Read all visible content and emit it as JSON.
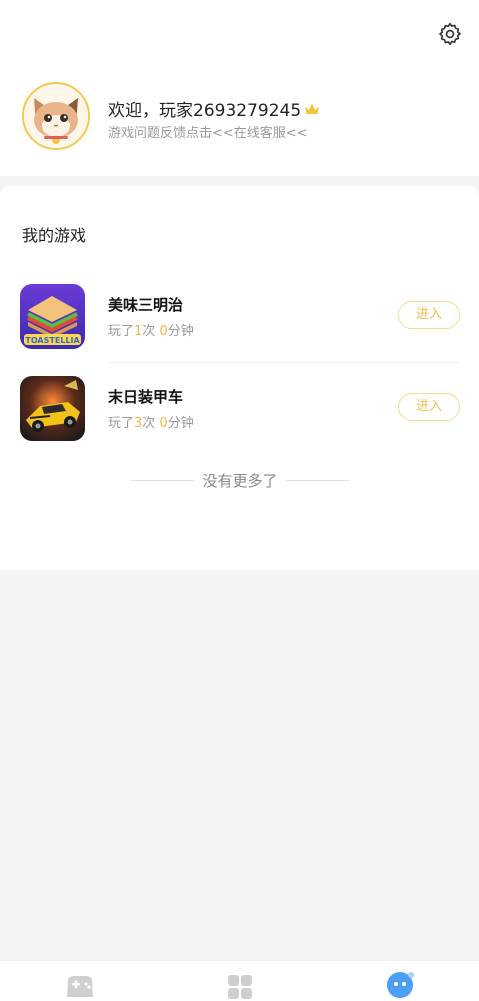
{
  "header": {
    "welcome_text": "欢迎，玩家2693279245",
    "feedback_text": "游戏问题反馈点击<<在线客服<<",
    "icons": {
      "settings": "gear-icon",
      "vip": "crown-icon",
      "avatar": "cat-avatar"
    }
  },
  "my_games": {
    "title": "我的游戏",
    "games": [
      {
        "name": "美味三明治",
        "icon": "sandwich-game-icon",
        "icon_text": "TOASTELLIA",
        "played_prefix": "玩了",
        "play_count": "1",
        "count_unit": "次",
        "minutes": "0",
        "minutes_unit": "分钟",
        "enter_label": "进入"
      },
      {
        "name": "末日装甲车",
        "icon": "armored-car-game-icon",
        "played_prefix": "玩了",
        "play_count": "3",
        "count_unit": "次",
        "minutes": "0",
        "minutes_unit": "分钟",
        "enter_label": "进入"
      }
    ],
    "end_text": "没有更多了"
  },
  "tabbar": {
    "tabs": [
      {
        "icon": "gamepad-icon",
        "active": false
      },
      {
        "icon": "grid-icon",
        "active": false
      },
      {
        "icon": "profile-bubble-icon",
        "active": true
      }
    ]
  },
  "colors": {
    "accent_gold": "#f0b942",
    "active_blue": "#4a9ff5",
    "enter_border": "#f6dc8d"
  }
}
